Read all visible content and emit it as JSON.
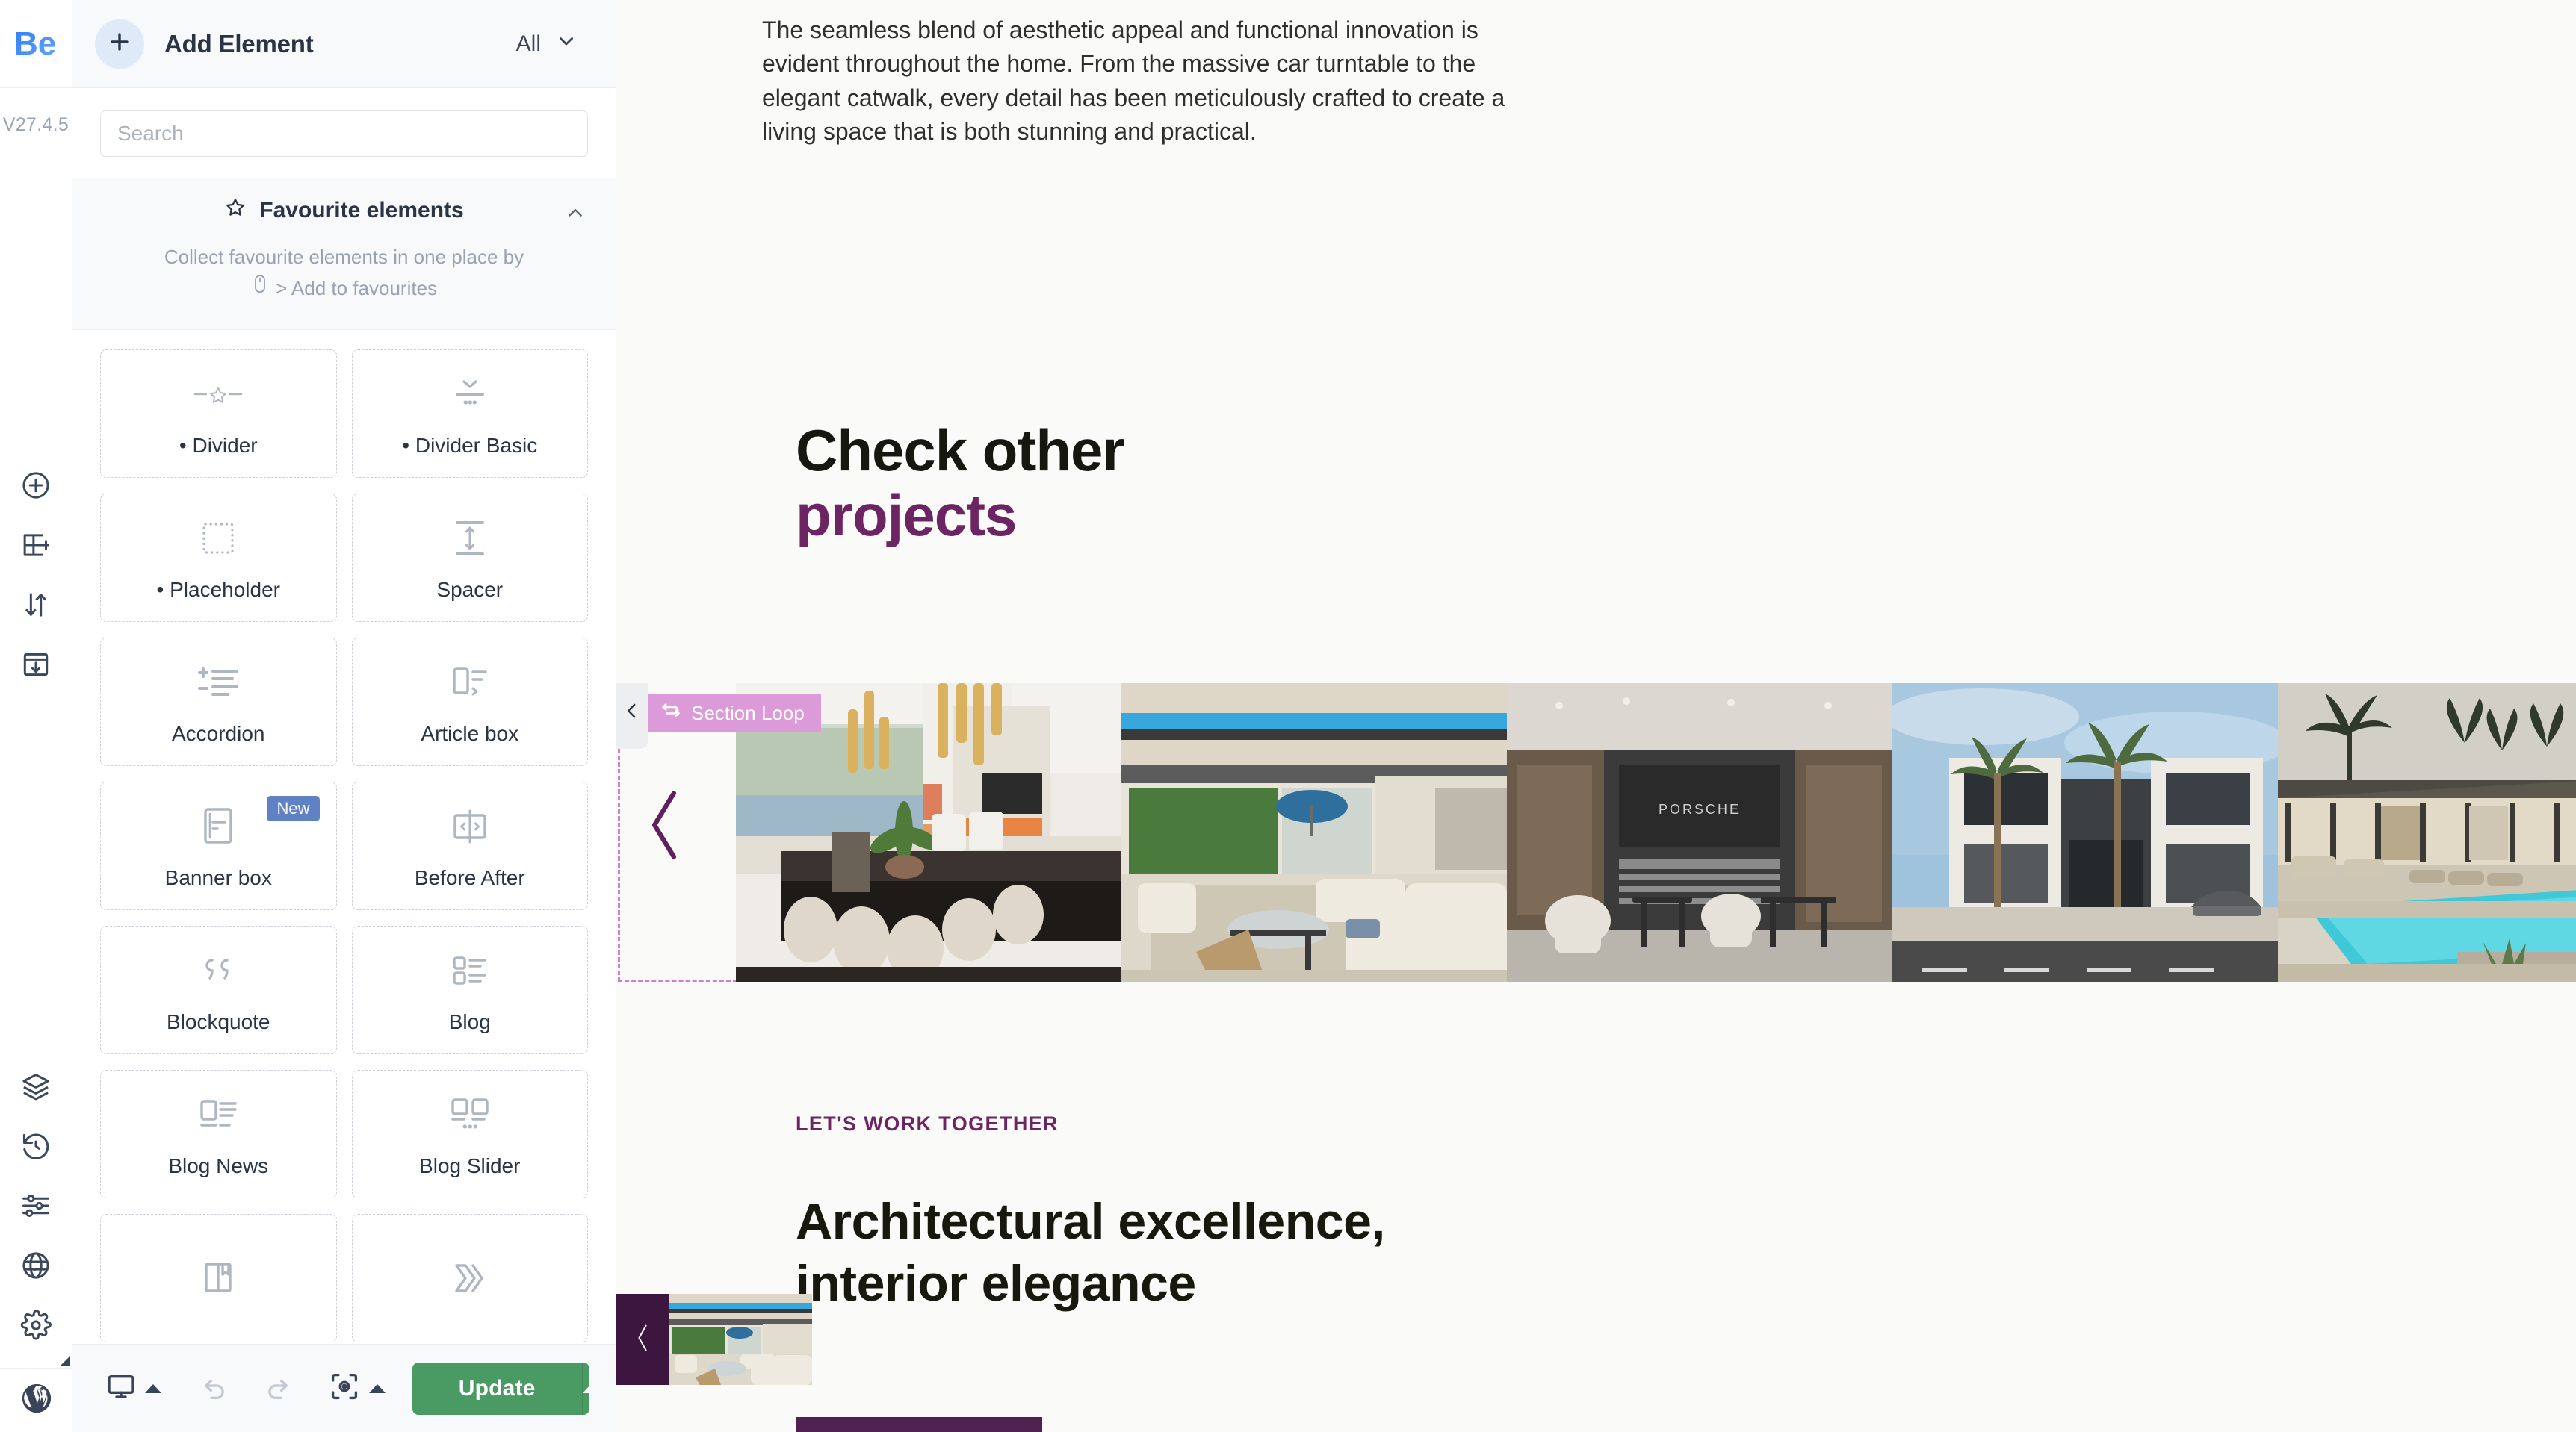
{
  "app": {
    "logo_text": "Be",
    "version": "V27.4.5",
    "brand_blue": "#3b82f6",
    "accent_purple": "#6d2462",
    "update_green": "#4a9a63"
  },
  "rail": {
    "items": [
      {
        "name": "add-element",
        "icon": "plus-circle-icon"
      },
      {
        "name": "add-section",
        "icon": "add-section-icon"
      },
      {
        "name": "move-section",
        "icon": "move-updown-icon"
      },
      {
        "name": "save-template",
        "icon": "save-template-icon"
      },
      {
        "name": "layers",
        "icon": "layers-icon"
      },
      {
        "name": "history",
        "icon": "history-icon"
      },
      {
        "name": "global-settings",
        "icon": "sliders-icon"
      },
      {
        "name": "globe",
        "icon": "globe-icon"
      },
      {
        "name": "settings",
        "icon": "gear-icon"
      }
    ],
    "wordpress_label": "WordPress"
  },
  "panel": {
    "title": "Add Element",
    "filter_value": "All",
    "search": {
      "placeholder": "Search",
      "value": ""
    },
    "favourites": {
      "heading": "Favourite elements",
      "description_line1": "Collect favourite elements in one place by",
      "description_line2": "> Add to favourites"
    },
    "elements": [
      {
        "label": "• Divider",
        "icon": "divider-star-icon",
        "new": false
      },
      {
        "label": "• Divider Basic",
        "icon": "divider-basic-icon",
        "new": false
      },
      {
        "label": "• Placeholder",
        "icon": "placeholder-icon",
        "new": false
      },
      {
        "label": "Spacer",
        "icon": "spacer-icon",
        "new": false
      },
      {
        "label": "Accordion",
        "icon": "accordion-icon",
        "new": false
      },
      {
        "label": "Article box",
        "icon": "article-box-icon",
        "new": false
      },
      {
        "label": "Banner box",
        "icon": "banner-box-icon",
        "new": true
      },
      {
        "label": "Before After",
        "icon": "before-after-icon",
        "new": false
      },
      {
        "label": "Blockquote",
        "icon": "blockquote-icon",
        "new": false
      },
      {
        "label": "Blog",
        "icon": "blog-icon",
        "new": false
      },
      {
        "label": "Blog News",
        "icon": "blog-news-icon",
        "new": false
      },
      {
        "label": "Blog Slider",
        "icon": "blog-slider-icon",
        "new": false
      },
      {
        "label": "",
        "icon": "book-icon",
        "new": false
      },
      {
        "label": "",
        "icon": "chevrons-icon",
        "new": false
      }
    ],
    "badge_new_label": "New",
    "footer": {
      "device_label": "Desktop",
      "undo_label": "Undo",
      "redo_label": "Redo",
      "preview_label": "Preview",
      "update_label": "Update"
    }
  },
  "canvas": {
    "intro_paragraph": "The seamless blend of aesthetic appeal and functional innovation is evident throughout the home. From the massive car turntable to the elegant catwalk, every detail has been meticulously crafted to create a living space that is both stunning and practical.",
    "check_heading_line1": "Check other",
    "check_heading_line2": "projects",
    "section_loop_label": "Section Loop",
    "eyebrow": "LET'S WORK TOGETHER",
    "arch_heading_line1": "Architectural excellence,",
    "arch_heading_line2": "interior elegance",
    "slides": [
      {
        "name": "dining-room-pendant-lights"
      },
      {
        "name": "living-room-patio"
      },
      {
        "name": "porsche-garage-lounge"
      },
      {
        "name": "modern-villa-palms"
      },
      {
        "name": "poolside-villa-dusk"
      }
    ]
  }
}
